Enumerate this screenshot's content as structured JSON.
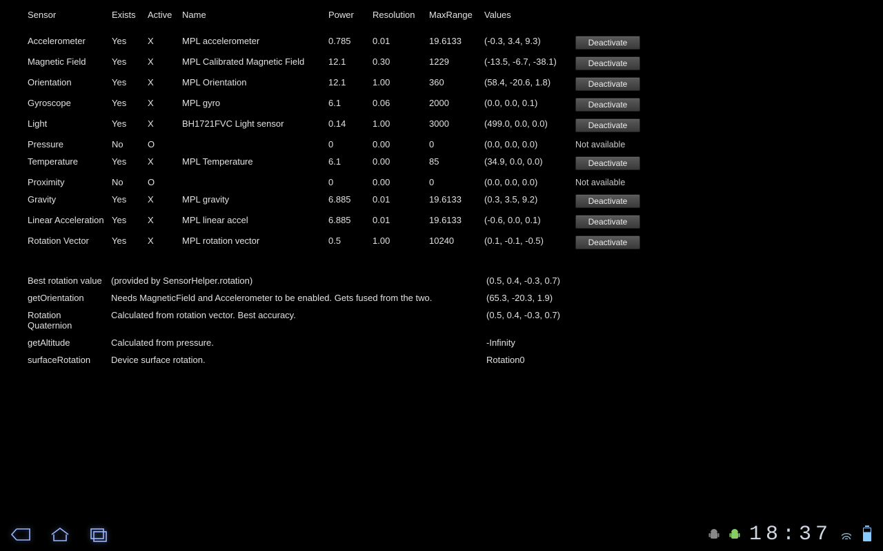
{
  "headers": {
    "sensor": "Sensor",
    "exists": "Exists",
    "active": "Active",
    "name": "Name",
    "power": "Power",
    "resolution": "Resolution",
    "maxrange": "MaxRange",
    "values": "Values"
  },
  "buttons": {
    "deactivate": "Deactivate",
    "not_available": "Not available"
  },
  "sensors": [
    {
      "sensor": "Accelerometer",
      "exists": "Yes",
      "active": "X",
      "name": "MPL accelerometer",
      "power": "0.785",
      "resolution": "0.01",
      "maxrange": "19.6133",
      "values": "(-0.3, 3.4, 9.3)",
      "available": true
    },
    {
      "sensor": "Magnetic Field",
      "exists": "Yes",
      "active": "X",
      "name": "MPL Calibrated Magnetic Field",
      "power": "12.1",
      "resolution": "0.30",
      "maxrange": "1229",
      "values": "(-13.5, -6.7, -38.1)",
      "available": true
    },
    {
      "sensor": "Orientation",
      "exists": "Yes",
      "active": "X",
      "name": "MPL Orientation",
      "power": "12.1",
      "resolution": "1.00",
      "maxrange": "360",
      "values": "(58.4, -20.6, 1.8)",
      "available": true
    },
    {
      "sensor": "Gyroscope",
      "exists": "Yes",
      "active": "X",
      "name": "MPL gyro",
      "power": "6.1",
      "resolution": "0.06",
      "maxrange": "2000",
      "values": "(0.0, 0.0, 0.1)",
      "available": true
    },
    {
      "sensor": "Light",
      "exists": "Yes",
      "active": "X",
      "name": "BH1721FVC Light sensor",
      "power": "0.14",
      "resolution": "1.00",
      "maxrange": "3000",
      "values": "(499.0, 0.0, 0.0)",
      "available": true
    },
    {
      "sensor": "Pressure",
      "exists": "No",
      "active": "O",
      "name": "",
      "power": "0",
      "resolution": "0.00",
      "maxrange": "0",
      "values": "(0.0, 0.0, 0.0)",
      "available": false
    },
    {
      "sensor": "Temperature",
      "exists": "Yes",
      "active": "X",
      "name": "MPL Temperature",
      "power": "6.1",
      "resolution": "0.00",
      "maxrange": "85",
      "values": "(34.9, 0.0, 0.0)",
      "available": true
    },
    {
      "sensor": "Proximity",
      "exists": "No",
      "active": "O",
      "name": "",
      "power": "0",
      "resolution": "0.00",
      "maxrange": "0",
      "values": "(0.0, 0.0, 0.0)",
      "available": false
    },
    {
      "sensor": "Gravity",
      "exists": "Yes",
      "active": "X",
      "name": "MPL gravity",
      "power": "6.885",
      "resolution": "0.01",
      "maxrange": "19.6133",
      "values": "(0.3, 3.5, 9.2)",
      "available": true
    },
    {
      "sensor": "Linear Acceleration",
      "exists": "Yes",
      "active": "X",
      "name": "MPL linear accel",
      "power": "6.885",
      "resolution": "0.01",
      "maxrange": "19.6133",
      "values": "(-0.6, 0.0, 0.1)",
      "available": true,
      "wrap": true
    },
    {
      "sensor": "Rotation Vector",
      "exists": "Yes",
      "active": "X",
      "name": "MPL rotation vector",
      "power": "0.5",
      "resolution": "1.00",
      "maxrange": "10240",
      "values": "(0.1, -0.1, -0.5)",
      "available": true
    }
  ],
  "derived": [
    {
      "label": "Best rotation value",
      "desc": "(provided by SensorHelper.rotation)",
      "value": "(0.5, 0.4, -0.3, 0.7)"
    },
    {
      "label": "getOrientation",
      "desc": "Needs MagneticField and Accelerometer to be enabled. Gets fused from the two.",
      "value": "(65.3, -20.3, 1.9)"
    },
    {
      "label": "Rotation Quaternion",
      "desc": "Calculated from rotation vector. Best accuracy.",
      "value": "(0.5, 0.4, -0.3, 0.7)",
      "wrap": true
    },
    {
      "label": "getAltitude",
      "desc": "Calculated from pressure.",
      "value": "-Infinity"
    },
    {
      "label": "surfaceRotation",
      "desc": "Device surface rotation.",
      "value": "Rotation0"
    }
  ],
  "sysbar": {
    "time": "18:37"
  }
}
